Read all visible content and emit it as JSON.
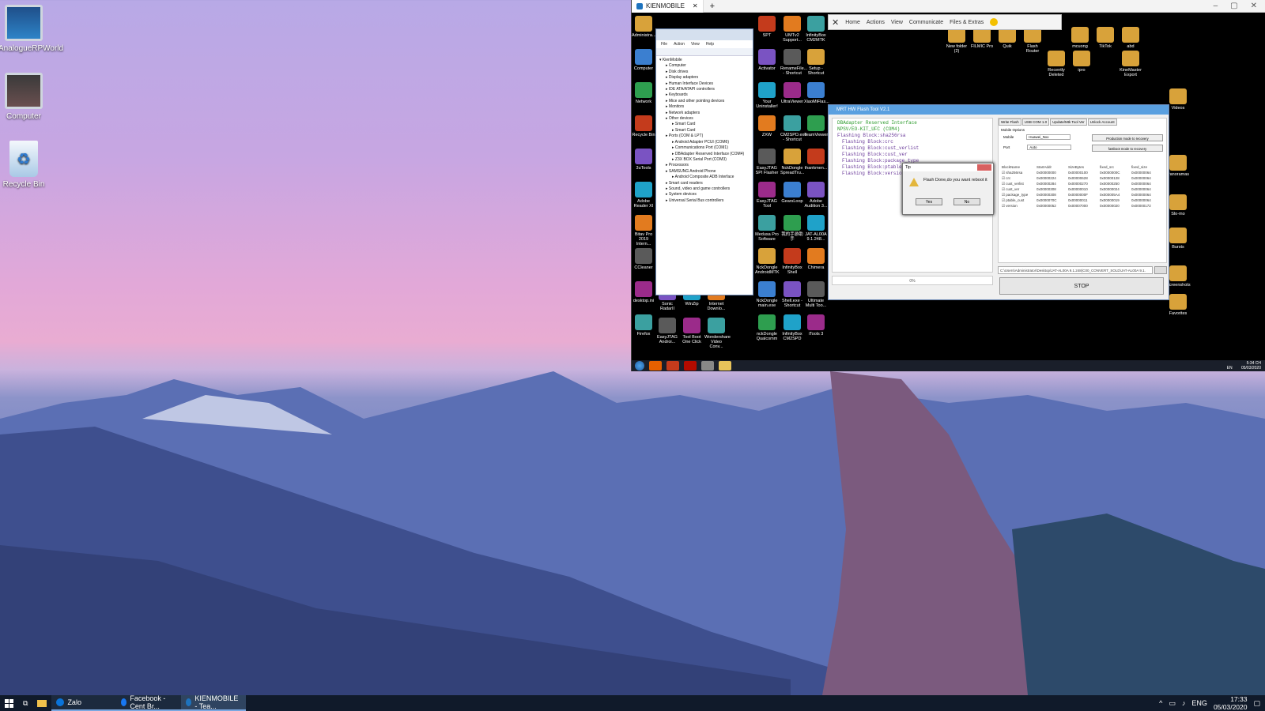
{
  "desktop": {
    "icons": [
      {
        "label": "AnalogueRPWorld",
        "icon": "monitor-icon",
        "color": "#2c6ba8"
      },
      {
        "label": "Computer",
        "icon": "computer-icon",
        "color": "#444444"
      },
      {
        "label": "Recycle Bin",
        "icon": "recycle-bin-icon",
        "color": "#9fc7ea"
      }
    ]
  },
  "taskbar": {
    "apps": [
      {
        "label": "Zalo",
        "color": "#0a73d9"
      },
      {
        "label": "Facebook - Cent Br...",
        "color": "#1877f2"
      },
      {
        "label": "KIENMOBILE - Tea...",
        "color": "#1e73be"
      }
    ],
    "lang": "ENG",
    "time": "17:33",
    "date": "05/03/2020"
  },
  "teamviewer": {
    "tab_title": "KIENMOBILE",
    "toolbar": [
      "Home",
      "Actions",
      "View",
      "Communicate",
      "Files & Extras"
    ],
    "remote_icons_left": [
      [
        "Administra...",
        "Computer",
        "Network",
        "Recycle Bin",
        "3uTools",
        "Adobe Reader XI",
        "Bitav Pro 2019 Intern...",
        "CCleaner",
        "desktop.ini",
        "Firefox"
      ],
      [
        "SPT",
        "Activator",
        "Your Uninstaller!",
        "ZXW",
        "EasyJTAG SPI Flasher",
        "EasyJTAG Tool",
        "Medusa Pro Software",
        "NckDongle AndroidMTK",
        "NckDongle main.exe",
        "nckDongle Qualcomm"
      ],
      [
        "UMTv2 Support...",
        "RenameFile... - Shortcut",
        "UltraViewer",
        "CM2SPD.exe - Shortcut",
        "NckDongle SpreadTru...",
        "GearsLoop",
        "我的手游助手",
        "InfinityBox Shell",
        "Shell.exe - Shortcut",
        "InfinityBox CM2SPD"
      ],
      [
        "InfinityBox CM2MTK",
        "Setup - Shortcut",
        "XiaoMiFlas...",
        "TeamViewer",
        "thankmen...",
        "Adobe Audition 3...",
        "JAT-AL00A 9.1.248...",
        "Chimera",
        "Ultimate Multi Too...",
        "iTools 3"
      ]
    ],
    "remote_icons_bottom": [
      "Sonic RadarII",
      "WinZip",
      "Internet Downlo...",
      "EasyJTAG Androi...",
      "Tool Boot One Click",
      "Wondershare Video Conv..."
    ],
    "remote_icons_right": [
      "New folder (2)",
      "FILMIC Pro",
      "Quik",
      "Flash Router",
      "mcuong",
      "TikTok",
      "abd",
      "Recently Deleted",
      "ipro",
      "KineMaster Export",
      "Videos",
      "Panoramas",
      "Slo-mo",
      "Bursts",
      "Screenshots",
      "Favorites"
    ],
    "device_manager": {
      "menu": [
        "File",
        "Action",
        "View",
        "Help"
      ],
      "tree": [
        "KienMobile",
        "Computer",
        "Disk drives",
        "Display adapters",
        "Human Interface Devices",
        "IDE ATA/ATAPI controllers",
        "Keyboards",
        "Mice and other pointing devices",
        "Monitors",
        "Network adapters",
        "Other devices",
        "Smart Card",
        "Smart Card",
        "Ports (COM & LPT)",
        "Android Adapter PCUI (COM6)",
        "Communications Port (COM1)",
        "DBAdapter Reserved Interface (COM4)",
        "Z3X BOX Serial Port (COM3)",
        "Processors",
        "SAMSUNG Android Phone",
        "Android Composite ADB Interface",
        "Smart card readers",
        "Sound, video and game controllers",
        "System devices",
        "Universal Serial Bus controllers"
      ]
    },
    "flash_tool": {
      "title": "MRT HW Flash Tool V2.1",
      "log": [
        "DBAdapter Reserved Interface",
        "NPSV/EO-KIT_UFC (COM4)",
        "Flashing Block:sha256rsa",
        "Flashing Block:crc",
        "Flashing Block:cust_verlist",
        "Flashing Block:cust_ver",
        "Flashing Block:package_type",
        "Flashing Block:ptable_cust",
        "Flashing Block:version"
      ],
      "status": "0%",
      "tabs": [
        "Write Flash",
        "USB COM 1.0",
        "Update/Mtk Tool Ver",
        "Unlock Account"
      ],
      "options_label": "Mobile Options",
      "mobile_label": "Mobile",
      "mobile_value": "Huawei_Nxx",
      "port_label": "Port",
      "port_value": "Auto",
      "btn1": "Production mode to recovery",
      "btn2": "fastboot mode to recovery",
      "columns": [
        "BlockName",
        "StartAddr",
        "SizeBytes",
        "fixed_src",
        "fixed_size"
      ],
      "rows": [
        [
          "sha256rsa",
          "0x00000000",
          "0x00000100",
          "0x0000000C",
          "0x00000064"
        ],
        [
          "crc",
          "0x00000224",
          "0x00000628",
          "0x00000128",
          "0x00000064"
        ],
        [
          "cust_verlist",
          "0x00000284",
          "0x00000270",
          "0x00000250",
          "0x00000064"
        ],
        [
          "cust_ver",
          "0x00000308",
          "0x00000010",
          "0x00000024",
          "0x00000064"
        ],
        [
          "package_type",
          "0x00000308",
          "0x0000000F",
          "0x000005A4",
          "0x00000064"
        ],
        [
          "ptable_cust",
          "0x0000070C",
          "0x00000011",
          "0x00000019",
          "0x00000064"
        ],
        [
          "version",
          "0x00000052",
          "0x00007000",
          "0x00000020",
          "0x00000172"
        ]
      ],
      "path": "C:\\Users\\Administrator\\Desktop\\JAT-AL00A 9.1.248(C00_CONVERT_SOLD\\JAT-AL00A 9.1.",
      "stop": "STOP"
    },
    "dialog": {
      "title": "Tip",
      "message": "Flash Done,do you want reboot it",
      "yes": "Yes",
      "no": "No"
    },
    "remote_taskbar": {
      "lang": "EN",
      "time": "5:34 CH",
      "date": "05/03/2020"
    }
  }
}
